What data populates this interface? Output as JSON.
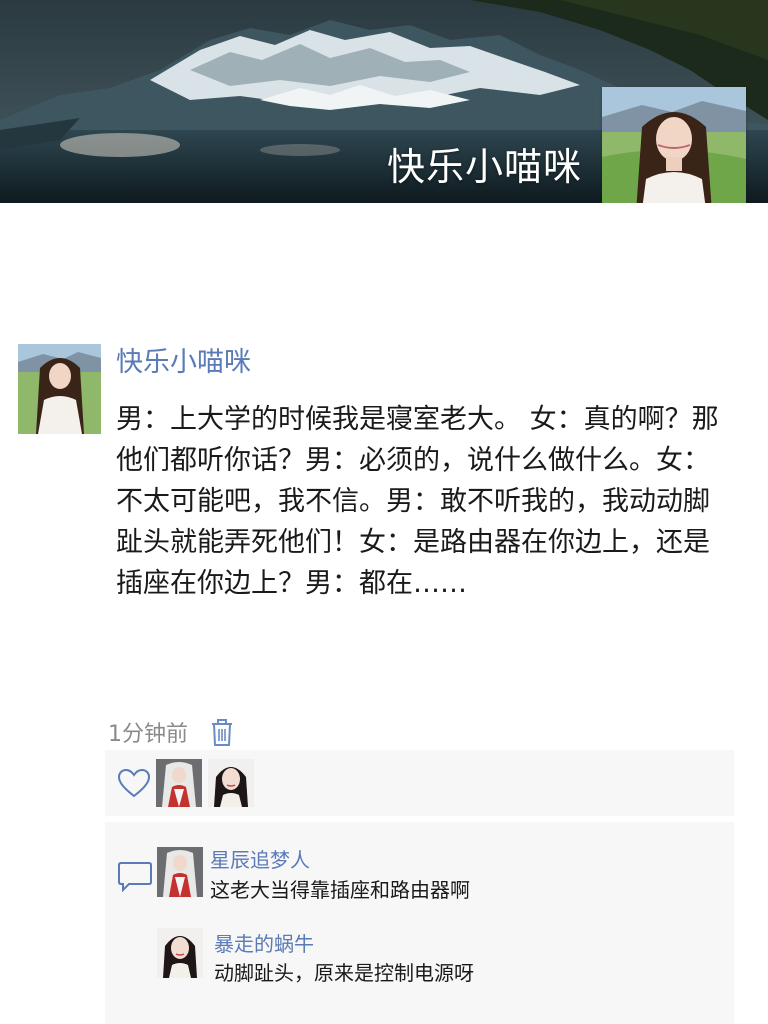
{
  "header": {
    "cover_title": "快乐小喵咪"
  },
  "post": {
    "author": "快乐小喵咪",
    "text": "男：上大学的时候我是寝室老大。 女：真的啊？那他们都听你话？男：必须的，说什么做什么。女：不太可能吧，我不信。男：敢不听我的，我动动脚趾头就能弄死他们！女：是路由器在你边上，还是插座在你边上？男：都在……",
    "time": "1分钟前"
  },
  "likes": {
    "icon": "heart-outline-icon"
  },
  "comments": [
    {
      "author": "星辰追梦人",
      "text": "这老大当得靠插座和路由器啊"
    },
    {
      "author": "暴走的蜗牛",
      "text": "动脚趾头，原来是控制电源呀"
    }
  ],
  "colors": {
    "name_link": "#5a7bb8",
    "body_text": "#1a1a1a",
    "meta_text": "#8a8a8a",
    "panel_bg": "#f7f7f7"
  }
}
